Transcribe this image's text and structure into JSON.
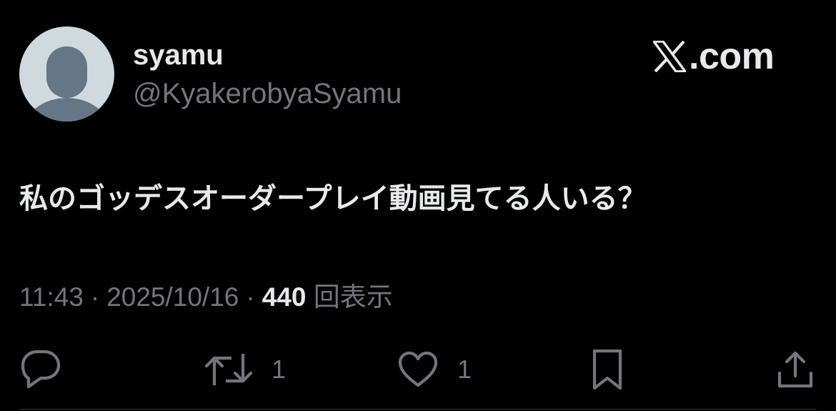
{
  "author": {
    "display_name": "syamu",
    "handle": "@KyakerobyaSyamu"
  },
  "brand": {
    "text": ".com",
    "logo_icon": "x-logo-icon"
  },
  "tweet": {
    "text": "私のゴッデスオーダープレイ動画見てる人いる？"
  },
  "meta": {
    "time": "11:43",
    "date": "2025/10/16",
    "separator": "·",
    "views_count": "440",
    "views_label": "回表示"
  },
  "actions": {
    "reply_icon": "reply-icon",
    "retweet_icon": "retweet-icon",
    "retweet_count": "1",
    "like_icon": "heart-icon",
    "like_count": "1",
    "bookmark_icon": "bookmark-icon",
    "share_icon": "share-icon"
  },
  "colors": {
    "background": "#000000",
    "primary_text": "#e7e9ea",
    "secondary_text": "#71767b",
    "avatar_background": "#cfd9de",
    "avatar_figure": "#657786"
  }
}
